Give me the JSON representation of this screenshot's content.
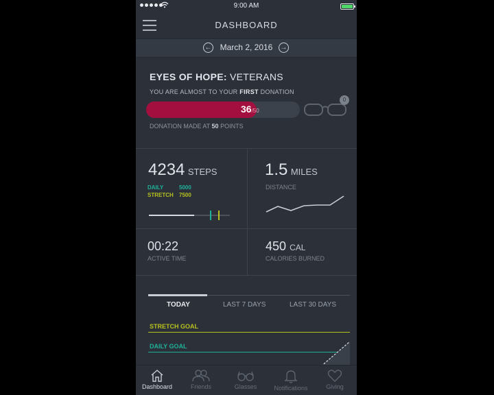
{
  "status_bar": {
    "time": "9:00 AM"
  },
  "header": {
    "title": "DASHBOARD"
  },
  "date_bar": {
    "date": "March 2, 2016"
  },
  "campaign": {
    "title_bold": "EYES OF HOPE:",
    "title_rest": "VETERANS",
    "subtitle_pre": "YOU ARE ALMOST TO YOUR",
    "subtitle_bold": "FIRST",
    "subtitle_post": "DONATION",
    "points": "36",
    "points_total": "/50",
    "progress_fraction": 0.72,
    "goal_badge": "0",
    "note_pre": "DONATION MADE AT",
    "note_bold": "50",
    "note_post": "POINTS"
  },
  "stats": {
    "steps_value": "4234",
    "steps_unit": "STEPS",
    "daily_label": "DAILY",
    "daily_value": "5000",
    "stretch_label": "STRETCH",
    "stretch_value": "7500",
    "steps_fraction": 0.56,
    "daily_fraction": 0.75,
    "stretch_fraction": 0.86,
    "miles_value": "1.5",
    "miles_unit": "MILES",
    "distance_label": "DISTANCE",
    "active_time_value": "00:22",
    "active_time_label": "ACTIVE TIME",
    "calories_value": "450",
    "calories_unit": "CAL",
    "calories_label": "CALORIES BURNED"
  },
  "tabs": [
    "TODAY",
    "LAST 7 DAYS",
    "LAST 30 DAYS"
  ],
  "goals": {
    "stretch": "STRETCH GOAL",
    "daily": "DAILY GOAL"
  },
  "nav": [
    "Dashboard",
    "Friends",
    "Glasses",
    "Notifications",
    "Giving"
  ],
  "colors": {
    "accent": "#a3103f",
    "daily": "#1fb29a",
    "stretch": "#b7c11f",
    "background": "#2b3039"
  }
}
